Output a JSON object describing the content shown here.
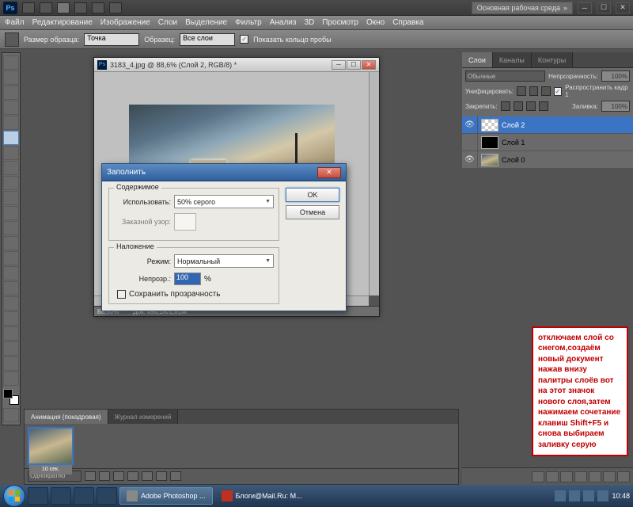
{
  "app": {
    "logo": "Ps"
  },
  "workspace_button": "Основная рабочая среда",
  "menubar": [
    "Файл",
    "Редактирование",
    "Изображение",
    "Слои",
    "Выделение",
    "Фильтр",
    "Анализ",
    "3D",
    "Просмотр",
    "Окно",
    "Справка"
  ],
  "optionbar": {
    "sample_size_label": "Размер образца:",
    "sample_size_value": "Точка",
    "sample_label": "Образец:",
    "sample_value": "Все слои",
    "show_ring_label": "Показать кольцо пробы"
  },
  "document": {
    "title": "3183_4.jpg @ 88,6% (Слой 2, RGB/8) *",
    "zoom": "88,50%",
    "doc_size": "Док: 696,1K/1,81M"
  },
  "fill_dialog": {
    "title": "Заполнить",
    "contents_label": "Содержимое",
    "use_label": "Использовать:",
    "use_value": "50% серого",
    "custom_pattern_label": "Заказной узор:",
    "blending_label": "Наложение",
    "mode_label": "Режим:",
    "mode_value": "Нормальный",
    "opacity_label": "Непрозр.:",
    "opacity_value": "100",
    "opacity_unit": "%",
    "preserve_label": "Сохранить прозрачность",
    "ok": "OK",
    "cancel": "Отмена"
  },
  "layers_panel": {
    "tabs": [
      "Слои",
      "Каналы",
      "Контуры"
    ],
    "blend_mode": "Обычные",
    "opacity_label": "Непрозрачность:",
    "opacity_value": "100%",
    "unif_label": "Унифицировать:",
    "propagate_label": "Распространить кадр 1",
    "lock_label": "Закрепить:",
    "fill_label": "Заливка:",
    "fill_value": "100%",
    "layers": [
      {
        "name": "Слой 2",
        "selected": true,
        "visible": true,
        "thumb": "chk"
      },
      {
        "name": "Слой 1",
        "selected": false,
        "visible": false,
        "thumb": "dark"
      },
      {
        "name": "Слой 0",
        "selected": false,
        "visible": true,
        "thumb": "img"
      }
    ]
  },
  "animation_panel": {
    "tabs": [
      "Анимация (покадровая)",
      "Журнал измерений"
    ],
    "frame_duration": "10 сек.",
    "repeat": "Однократно"
  },
  "annotation_text": "отключаем слой со снегом,создаём новый документ нажав внизу палитры слоёв вот на этот значок нового слоя,затем нажимаем сочетание клавиш Shift+F5 и снова выбираем заливку серую",
  "taskbar": {
    "apps": [
      {
        "label": "Adobe Photoshop ...",
        "color": "#0a2a5a"
      },
      {
        "label": "Блоги@Mail.Ru: М...",
        "color": "#c03020"
      }
    ],
    "time": "10:48"
  }
}
